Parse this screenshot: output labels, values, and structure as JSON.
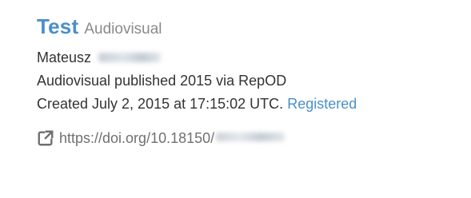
{
  "item": {
    "title": "Test",
    "resource_type": "Audiovisual",
    "creator_first_name": "Mateusz",
    "creator_last_name_redacted": "Neumann",
    "published_line": "Audiovisual published 2015 via RepOD",
    "created_line": "Created July 2, 2015 at 17:15:02 UTC.",
    "status_link": "Registered",
    "doi_prefix": "https://doi.org/10.18150/",
    "doi_suffix_redacted": "REDACTED",
    "icon": "external-link-icon",
    "colors": {
      "link": "#4a8fca",
      "muted": "#8a8a8a",
      "text": "#333333",
      "doi": "#707070"
    }
  }
}
